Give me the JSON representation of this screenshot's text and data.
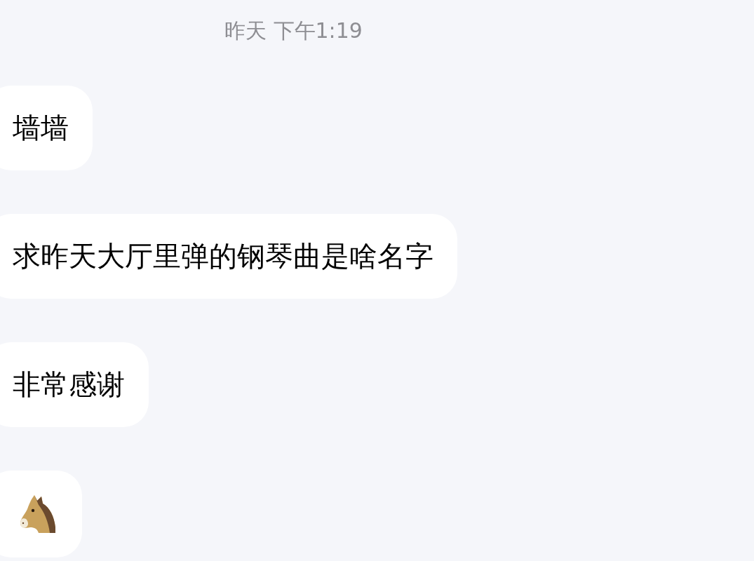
{
  "timestamp": "昨天 下午1:19",
  "messages": [
    {
      "kind": "text",
      "text": "墙墙"
    },
    {
      "kind": "text",
      "text": "求昨天大厅里弹的钢琴曲是啥名字"
    },
    {
      "kind": "text",
      "text": "非常感谢"
    },
    {
      "kind": "emoji"
    }
  ]
}
